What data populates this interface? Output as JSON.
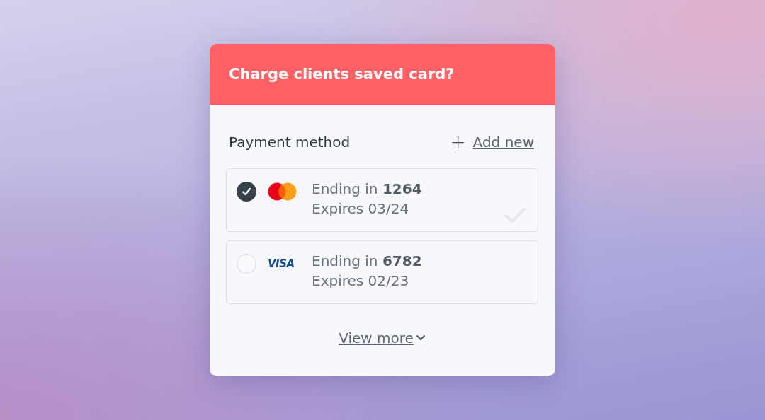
{
  "dialog": {
    "title": "Charge clients saved card?"
  },
  "payment_method": {
    "label": "Payment method",
    "add_icon": "+",
    "add_link": "Add new"
  },
  "cards": [
    {
      "kind": "mastercard",
      "selected": true,
      "ending": "Ending in **1264**",
      "expires": "Expires 03/24"
    },
    {
      "kind": "visa",
      "selected": false,
      "logo_text": "VISA",
      "ending": "Ending in **6782**",
      "expires": "Expires 02/23"
    }
  ],
  "view_more": "View more"
}
